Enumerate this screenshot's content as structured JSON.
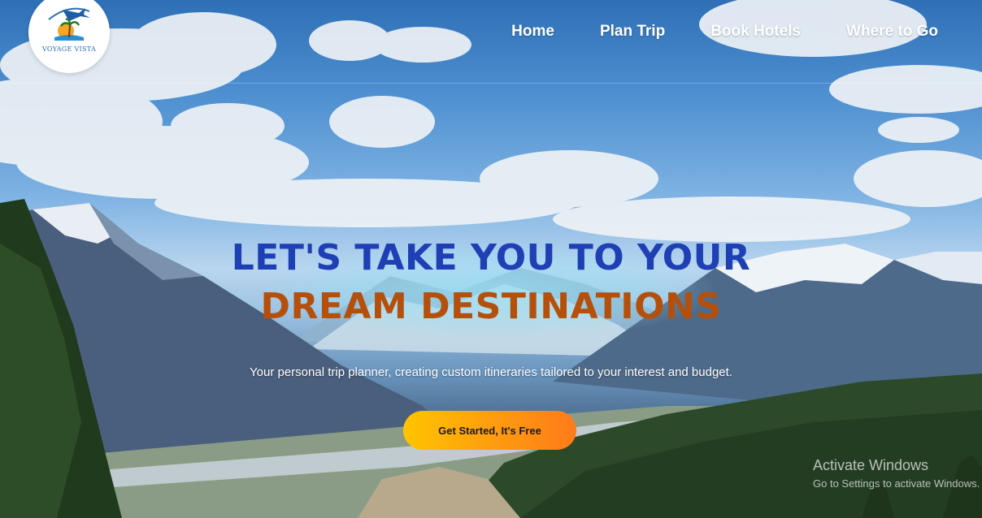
{
  "logo": {
    "text": "VOYAGE VISTA"
  },
  "nav": {
    "items": [
      {
        "label": "Home"
      },
      {
        "label": "Plan Trip"
      },
      {
        "label": "Book Hotels"
      },
      {
        "label": "Where to Go"
      }
    ]
  },
  "hero": {
    "line1": "LET'S TAKE YOU TO YOUR",
    "line2": "DREAM DESTINATIONS",
    "subtitle": "Your personal trip planner, creating custom itineraries tailored to your interest and budget.",
    "cta_label": "Get Started, It's Free"
  },
  "watermark": {
    "title": "Activate Windows",
    "subtitle": "Go to Settings to activate Windows."
  },
  "colors": {
    "headline_blue": "#1f3fb5",
    "headline_orange": "#b4500c",
    "cta_start": "#ffc400",
    "cta_end": "#ff7a1a"
  }
}
